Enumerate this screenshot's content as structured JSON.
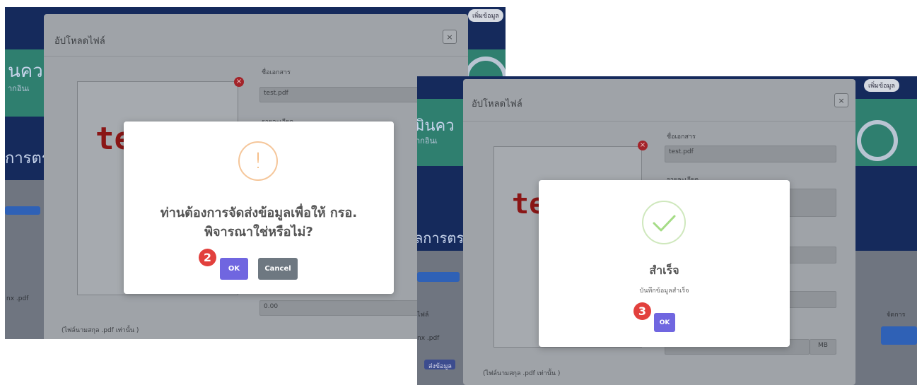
{
  "colors": {
    "app_navy": "#152a5c",
    "app_teal": "#2f7f6f",
    "ok_button": "#7066e0",
    "cancel_button": "#6e7881",
    "step_badge": "#e2403d",
    "warning": "#f3a75e",
    "success": "#a5dc86"
  },
  "shot1": {
    "bg": {
      "heading_fragment": "นคว",
      "sub_fragment": "ากอินเ",
      "section_fragment": "การตร",
      "row_fragment": "nx .pdf",
      "top_pill": "เพิ่มข้อมูล"
    },
    "upload_modal": {
      "title": "อัปโหลดไฟล์",
      "close_icon": "close-icon",
      "preview_text": "te",
      "filename_label": "ชื่อเอกสาร",
      "filename_value": "test.pdf",
      "detail_label": "รายละเอียด",
      "size_value": "0.00",
      "file_type_note": "(ไฟล์นามสกุล .pdf เท่านั้น )"
    },
    "dialog": {
      "icon": "warning-icon",
      "icon_glyph": "!",
      "title": "ท่านต้องการจัดส่งข้อมูลเพื่อให้ กรอ. พิจารณาใช่หรือไม่?",
      "confirm_label": "OK",
      "cancel_label": "Cancel",
      "step_number": "2"
    }
  },
  "shot2": {
    "bg": {
      "heading_fragment": "มินคว",
      "sub_fragment": "ากอินเ",
      "section_fragment": "ลการตร",
      "row_fragment": "nx .pdf",
      "side_label": "ชื่อ",
      "side_label2": "ไฟล์",
      "right_header": "จัดการ",
      "action_label": "ส่งข้อมูล",
      "top_pill": "เพิ่มข้อมูล"
    },
    "upload_modal": {
      "title": "อัปโหลดไฟล์",
      "close_icon": "close-icon",
      "preview_text": "te",
      "filename_label": "ชื่อเอกสาร",
      "filename_value": "test.pdf",
      "detail_label": "รายละเอียด",
      "size_value": "0.00",
      "size_unit": "MB",
      "file_type_note": "(ไฟล์นามสกุล .pdf เท่านั้น )"
    },
    "dialog": {
      "icon": "checkmark-icon",
      "title": "สำเร็จ",
      "message": "บันทึกข้อมูลสำเร็จ",
      "confirm_label": "OK",
      "step_number": "3"
    }
  }
}
